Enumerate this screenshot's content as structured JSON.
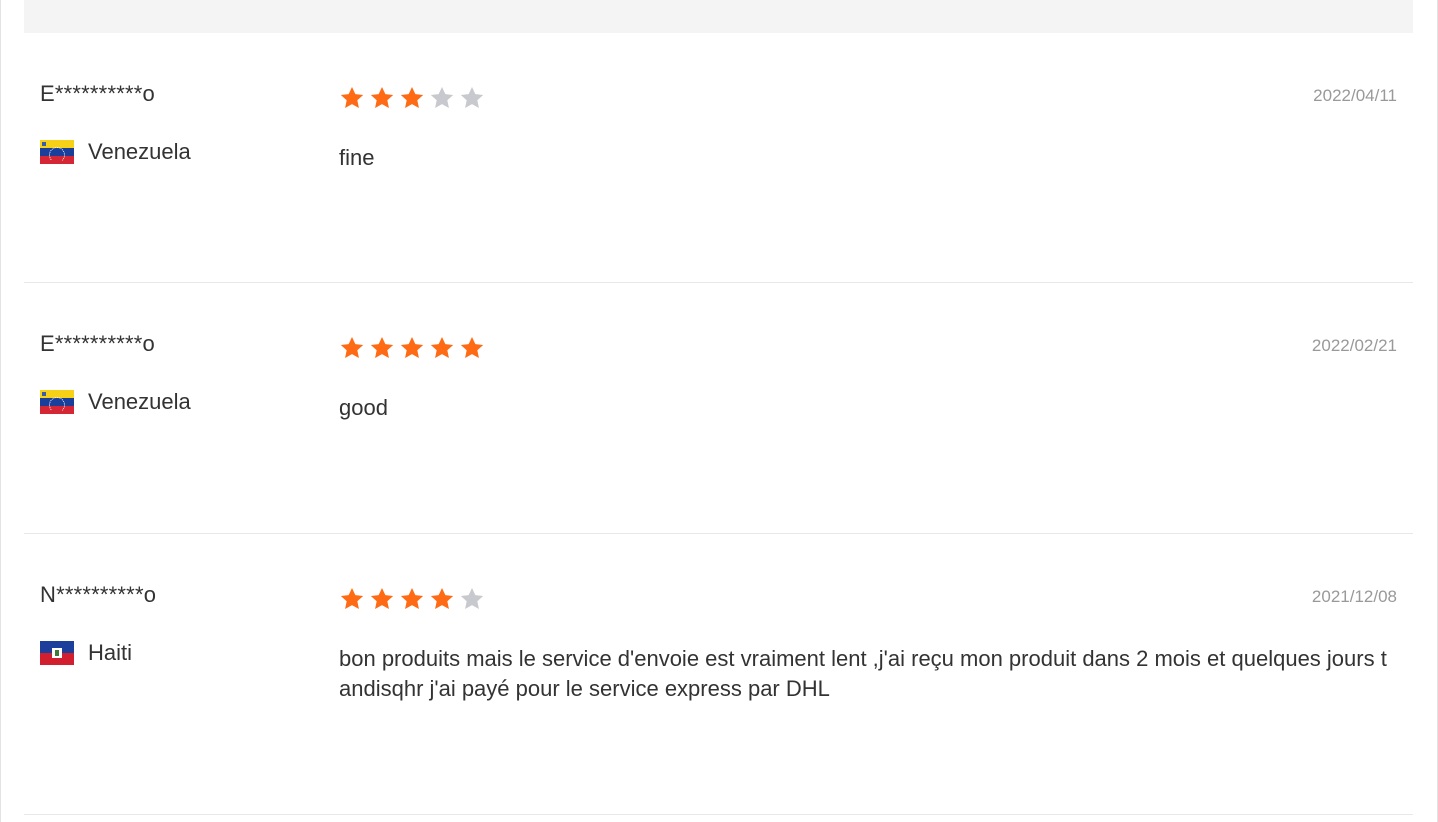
{
  "colors": {
    "star_filled": "#ff6a14",
    "star_empty": "#c8c9ce",
    "date_text": "#999999",
    "body_text": "#333333",
    "top_bar": "#f4f4f4"
  },
  "reviews": [
    {
      "reviewer": "E**********o",
      "country": "Venezuela",
      "flag_icon": "venezuela-flag-icon",
      "rating": 3,
      "max_rating": 5,
      "date": "2022/04/11",
      "comment": "fine"
    },
    {
      "reviewer": "E**********o",
      "country": "Venezuela",
      "flag_icon": "venezuela-flag-icon",
      "rating": 5,
      "max_rating": 5,
      "date": "2022/02/21",
      "comment": "good"
    },
    {
      "reviewer": "N**********o",
      "country": "Haiti",
      "flag_icon": "haiti-flag-icon",
      "rating": 4,
      "max_rating": 5,
      "date": "2021/12/08",
      "comment": "bon produits mais le service d'envoie est vraiment lent ,j'ai reçu mon produit dans 2 mois et quelques jours tandisqhr j'ai payé pour le service express par DHL"
    }
  ]
}
